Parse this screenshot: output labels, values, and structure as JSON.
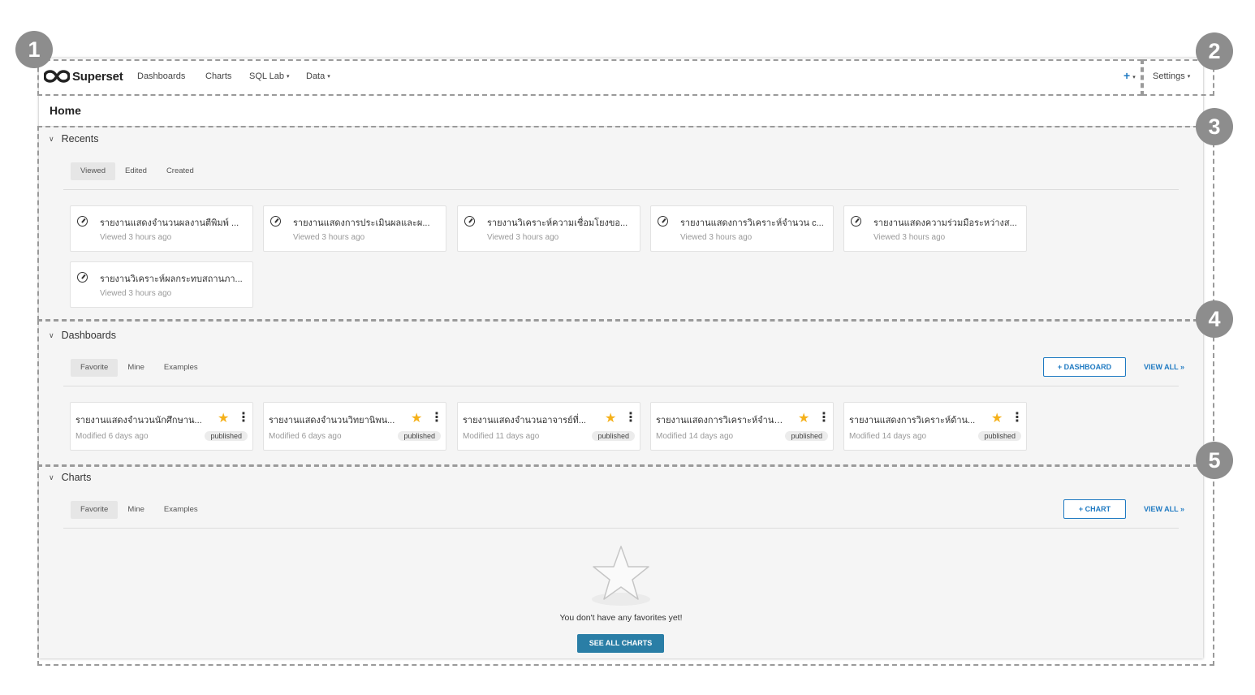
{
  "navbar": {
    "brand": "Superset",
    "items": [
      {
        "label": "Dashboards",
        "caret": false
      },
      {
        "label": "Charts",
        "caret": false
      },
      {
        "label": "SQL Lab",
        "caret": true
      },
      {
        "label": "Data",
        "caret": true
      }
    ],
    "plus_label": "+",
    "settings_label": "Settings",
    "caret_glyph": "▾"
  },
  "home": {
    "title": "Home"
  },
  "recents": {
    "heading": "Recents",
    "tabs": [
      "Viewed",
      "Edited",
      "Created"
    ],
    "active_tab": "Viewed",
    "items": [
      {
        "title": "รายงานแสดงจำนวนผลงานตีพิมพ์ ...",
        "subtitle": "Viewed 3 hours ago"
      },
      {
        "title": "รายงานแสดงการประเมินผลและผ...",
        "subtitle": "Viewed 3 hours ago"
      },
      {
        "title": "รายงานวิเคราะห์ความเชื่อมโยงขอ...",
        "subtitle": "Viewed 3 hours ago"
      },
      {
        "title": "รายงานแสดงการวิเคราะห์จำนวน c...",
        "subtitle": "Viewed 3 hours ago"
      },
      {
        "title": "รายงานแสดงความร่วมมือระหว่างส...",
        "subtitle": "Viewed 3 hours ago"
      },
      {
        "title": "รายงานวิเคราะห์ผลกระทบสถานภา...",
        "subtitle": "Viewed 3 hours ago"
      }
    ]
  },
  "dashboards": {
    "heading": "Dashboards",
    "tabs": [
      "Favorite",
      "Mine",
      "Examples"
    ],
    "active_tab": "Favorite",
    "add_button": "+ DASHBOARD",
    "view_all": "VIEW ALL »",
    "items": [
      {
        "title": "รายงานแสดงจำนวนนักศึกษาน...",
        "modified": "Modified 6 days ago",
        "status": "published",
        "favorite": true
      },
      {
        "title": "รายงานแสดงจำนวนวิทยานิพน...",
        "modified": "Modified 6 days ago",
        "status": "published",
        "favorite": true
      },
      {
        "title": "รายงานแสดงจำนวนอาจารย์ที่...",
        "modified": "Modified 11 days ago",
        "status": "published",
        "favorite": true
      },
      {
        "title": "รายงานแสดงการวิเคราะห์จำนว...",
        "modified": "Modified 14 days ago",
        "status": "published",
        "favorite": true
      },
      {
        "title": "รายงานแสดงการวิเคราะห์ด้าน...",
        "modified": "Modified 14 days ago",
        "status": "published",
        "favorite": true
      }
    ]
  },
  "charts": {
    "heading": "Charts",
    "tabs": [
      "Favorite",
      "Mine",
      "Examples"
    ],
    "active_tab": "Favorite",
    "add_button": "+ CHART",
    "view_all": "VIEW ALL »",
    "empty_message": "You don't have any favorites yet!",
    "see_all_button": "SEE ALL CHARTS"
  },
  "annotations": {
    "markers": [
      "1",
      "2",
      "3",
      "4",
      "5"
    ]
  },
  "colors": {
    "accent": "#1f7ac2",
    "primary_button": "#2a7ea6",
    "star": "#f5b11a",
    "marker": "#8d8d8d"
  },
  "icons": {
    "brand": "superset-infinity-logo",
    "recent_item": "dashboard-gauge-icon",
    "favorite": "star-icon",
    "more": "more-vertical-icon",
    "collapse": "chevron-down-icon",
    "empty_state": "empty-star-icon"
  }
}
